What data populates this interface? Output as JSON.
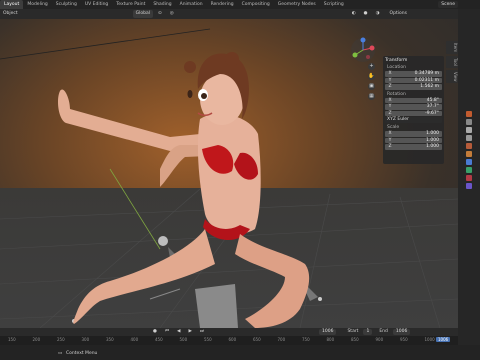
{
  "workspace_tabs": [
    "Layout",
    "Modeling",
    "Sculpting",
    "UV Editing",
    "Texture Paint",
    "Shading",
    "Animation",
    "Rendering",
    "Compositing",
    "Geometry Nodes",
    "Scripting"
  ],
  "scene_label": "Scene",
  "header": {
    "object_menu": "Object",
    "transform_orientation": "Global",
    "options_label": "Options"
  },
  "npanel": {
    "title": "Transform",
    "location_label": "Location",
    "location": [
      {
        "axis": "X",
        "value": "0.34789 m"
      },
      {
        "axis": "Y",
        "value": "0.02311 m"
      },
      {
        "axis": "Z",
        "value": "1.562 m"
      }
    ],
    "rotation_label": "Rotation",
    "rotation": [
      {
        "axis": "X",
        "value": "45.8°"
      },
      {
        "axis": "Y",
        "value": "37.7°"
      },
      {
        "axis": "Z",
        "value": "-9.67°"
      }
    ],
    "rotation_mode": "XYZ Euler",
    "scale_label": "Scale",
    "scale": [
      {
        "axis": "X",
        "value": "1.000"
      },
      {
        "axis": "Y",
        "value": "1.000"
      },
      {
        "axis": "Z",
        "value": "1.000"
      }
    ]
  },
  "side_tabs": [
    "Item",
    "Tool",
    "View"
  ],
  "timeline": {
    "current_frame": "1006",
    "start_label": "Start",
    "start": "1",
    "end_label": "End",
    "end": "1006",
    "ticks": [
      "150",
      "200",
      "250",
      "300",
      "350",
      "400",
      "450",
      "500",
      "550",
      "600",
      "650",
      "700",
      "750",
      "800",
      "850",
      "900",
      "950",
      "1000"
    ]
  },
  "status": {
    "context_menu": "Context Menu"
  },
  "colors": {
    "accent": "#4772b3",
    "bikini": "#c0171b",
    "skin": "#e8b49a"
  }
}
